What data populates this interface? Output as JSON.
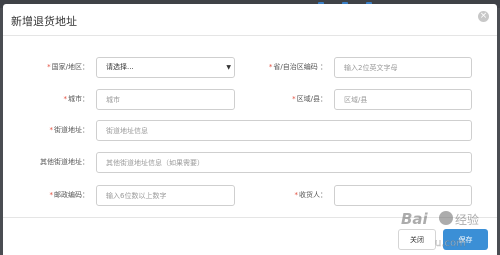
{
  "dialog": {
    "title": "新增退货地址",
    "close_symbol": "×"
  },
  "form": {
    "country": {
      "label": "国家/地区：",
      "required": true,
      "selected": "请选择..."
    },
    "province_code": {
      "label": "省/自治区编码 ：",
      "required": true,
      "placeholder": "输入2位英文字母"
    },
    "city": {
      "label": "城市：",
      "required": true,
      "placeholder": "城市"
    },
    "district": {
      "label": "区域/县：",
      "required": true,
      "placeholder": "区域/县"
    },
    "street": {
      "label": "街道地址：",
      "required": true,
      "placeholder": "街道地址信息"
    },
    "other_street": {
      "label": "其他街道地址：",
      "required": false,
      "placeholder": "其他街道地址信息（如果需要）"
    },
    "postcode": {
      "label": "邮政编码：",
      "required": true,
      "placeholder": "输入6位数以上数字"
    },
    "recipient": {
      "label": "收货人：",
      "required": true,
      "placeholder": ""
    }
  },
  "footer": {
    "close_label": "关闭",
    "save_label": "保存"
  },
  "icons": {
    "close": "close-icon",
    "caret": "caret-down-icon"
  },
  "watermark": {
    "text": "Bai 经验",
    "subtext": "u.com"
  }
}
